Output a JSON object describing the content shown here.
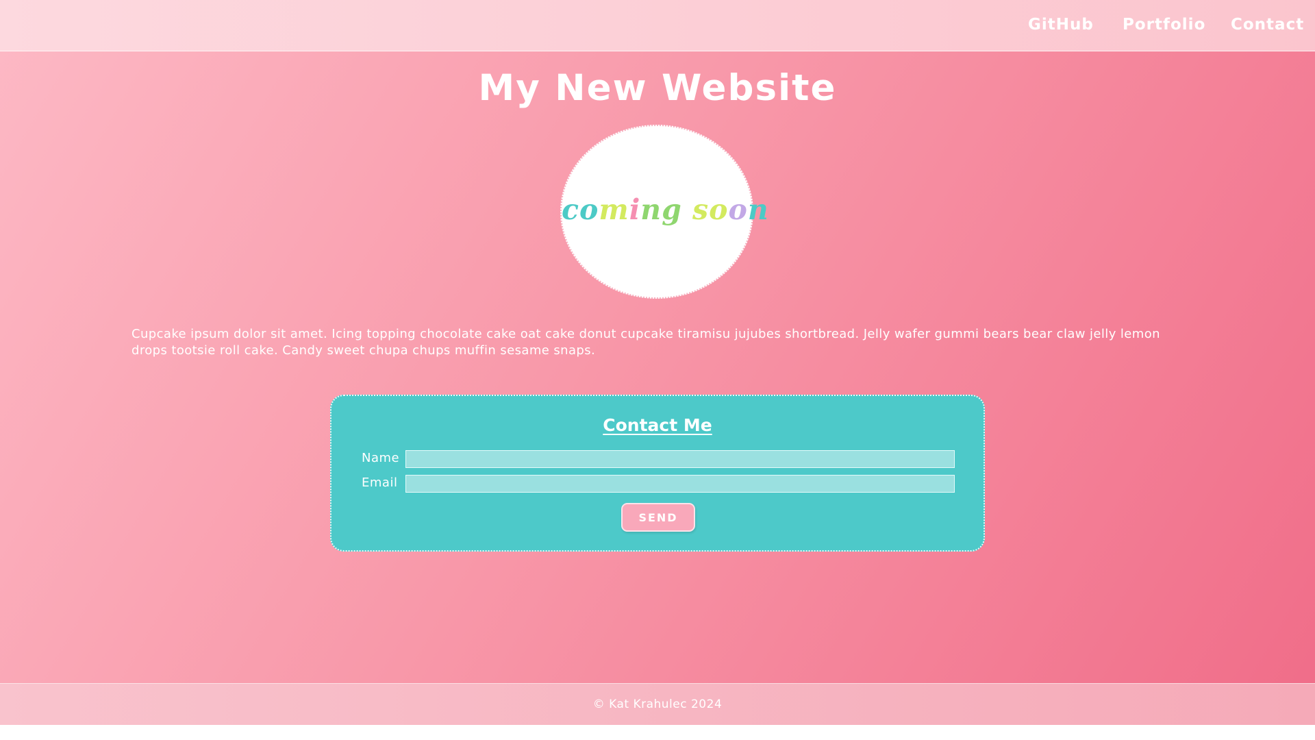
{
  "nav": {
    "items": [
      {
        "label": "GitHub"
      },
      {
        "label": "Portfolio"
      },
      {
        "label": "Contact"
      }
    ]
  },
  "header": {
    "title": "My New Website"
  },
  "hero": {
    "coming_soon_parts": [
      "co",
      "m",
      "i",
      "ng",
      " so",
      "o",
      "n"
    ],
    "colors": [
      "#4ccac6",
      "#8fd66f",
      "#d3ea5f",
      "#f58fb1",
      "#c2a8e6"
    ]
  },
  "intro": {
    "text": "Cupcake ipsum dolor sit amet. Icing topping chocolate cake oat cake donut cupcake tiramisu jujubes shortbread. Jelly wafer gummi bears bear claw jelly lemon drops tootsie roll cake. Candy sweet chupa chups muffin sesame snaps."
  },
  "contact": {
    "heading": "Contact Me",
    "name_label": "Name",
    "email_label": "Email",
    "name_value": "",
    "email_value": "",
    "send_label": "SEND"
  },
  "footer": {
    "text": "© Kat Krahulec 2024"
  },
  "theme": {
    "background_start": "#fdb9c5",
    "background_end": "#f06c88",
    "accent_teal": "#4dc9c9",
    "button_pink": "#f9a8ba"
  }
}
